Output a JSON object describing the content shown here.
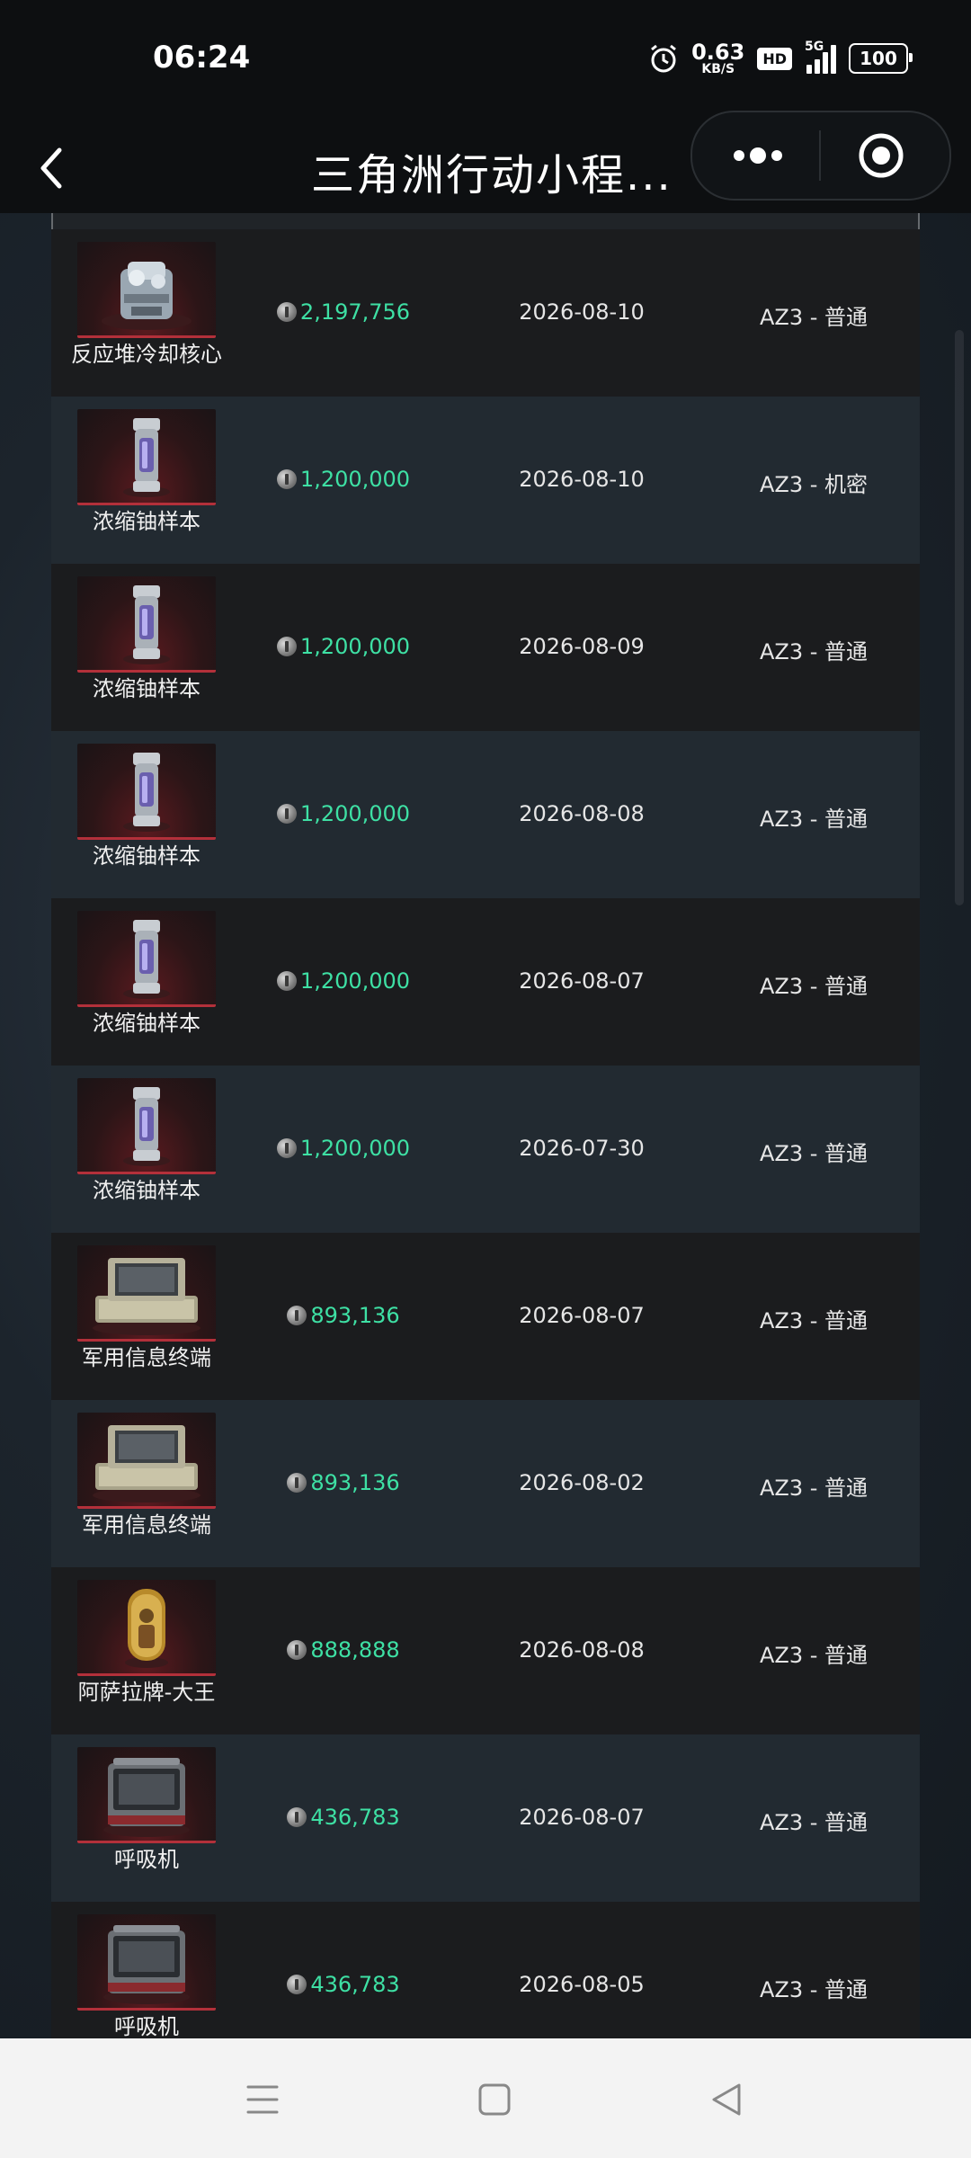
{
  "status": {
    "time": "06:24",
    "net_speed": "0.63",
    "net_unit": "KB/S",
    "hd": "HD",
    "network": "5G",
    "battery": "100"
  },
  "titlebar": {
    "title": "三角洲行动小程..."
  },
  "rows": [
    {
      "name": "反应堆冷却核心",
      "price": "2,197,756",
      "date": "2026-08-10",
      "map": "AZ3 - 普通",
      "icon": "reactor-core-icon"
    },
    {
      "name": "浓缩铀样本",
      "price": "1,200,000",
      "date": "2026-08-10",
      "map": "AZ3 - 机密",
      "icon": "uranium-sample-icon"
    },
    {
      "name": "浓缩铀样本",
      "price": "1,200,000",
      "date": "2026-08-09",
      "map": "AZ3 - 普通",
      "icon": "uranium-sample-icon"
    },
    {
      "name": "浓缩铀样本",
      "price": "1,200,000",
      "date": "2026-08-08",
      "map": "AZ3 - 普通",
      "icon": "uranium-sample-icon"
    },
    {
      "name": "浓缩铀样本",
      "price": "1,200,000",
      "date": "2026-08-07",
      "map": "AZ3 - 普通",
      "icon": "uranium-sample-icon"
    },
    {
      "name": "浓缩铀样本",
      "price": "1,200,000",
      "date": "2026-07-30",
      "map": "AZ3 - 普通",
      "icon": "uranium-sample-icon"
    },
    {
      "name": "军用信息终端",
      "price": "893,136",
      "date": "2026-08-07",
      "map": "AZ3 - 普通",
      "icon": "military-terminal-icon"
    },
    {
      "name": "军用信息终端",
      "price": "893,136",
      "date": "2026-08-02",
      "map": "AZ3 - 普通",
      "icon": "military-terminal-icon"
    },
    {
      "name": "阿萨拉牌-大王",
      "price": "888,888",
      "date": "2026-08-08",
      "map": "AZ3 - 普通",
      "icon": "asala-card-icon"
    },
    {
      "name": "呼吸机",
      "price": "436,783",
      "date": "2026-08-07",
      "map": "AZ3 - 普通",
      "icon": "ventilator-icon"
    },
    {
      "name": "呼吸机",
      "price": "436,783",
      "date": "2026-08-05",
      "map": "AZ3 - 普通",
      "icon": "ventilator-icon"
    }
  ]
}
